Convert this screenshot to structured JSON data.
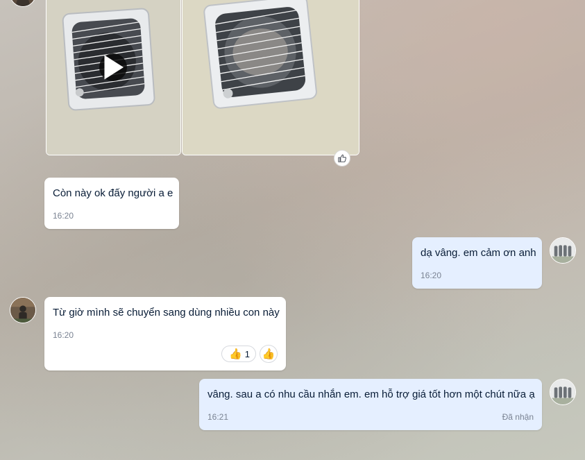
{
  "messages": [
    {
      "text": "Còn này ok đấy người a e",
      "time": "16:20"
    },
    {
      "text": "dạ vâng. em cảm ơn anh",
      "time": "16:20"
    },
    {
      "text": "Từ giờ mình sẽ chuyển sang dùng nhiều con này",
      "time": "16:20",
      "reaction": {
        "emoji": "👍",
        "count": "1"
      },
      "reaction_button": "👍"
    },
    {
      "text": "vâng. sau a có nhu cầu nhắn em. em hỗ trợ giá tốt hơn một chút nữa ạ",
      "time": "16:21",
      "status": "Đã nhận"
    }
  ],
  "media": {
    "play_icon": "play-icon",
    "like_icon": "thumbs-up-icon"
  },
  "colors": {
    "incoming_bubble": "#ffffff",
    "outgoing_bubble": "#e5efff",
    "text": "#081c36",
    "meta": "#7a8392"
  }
}
